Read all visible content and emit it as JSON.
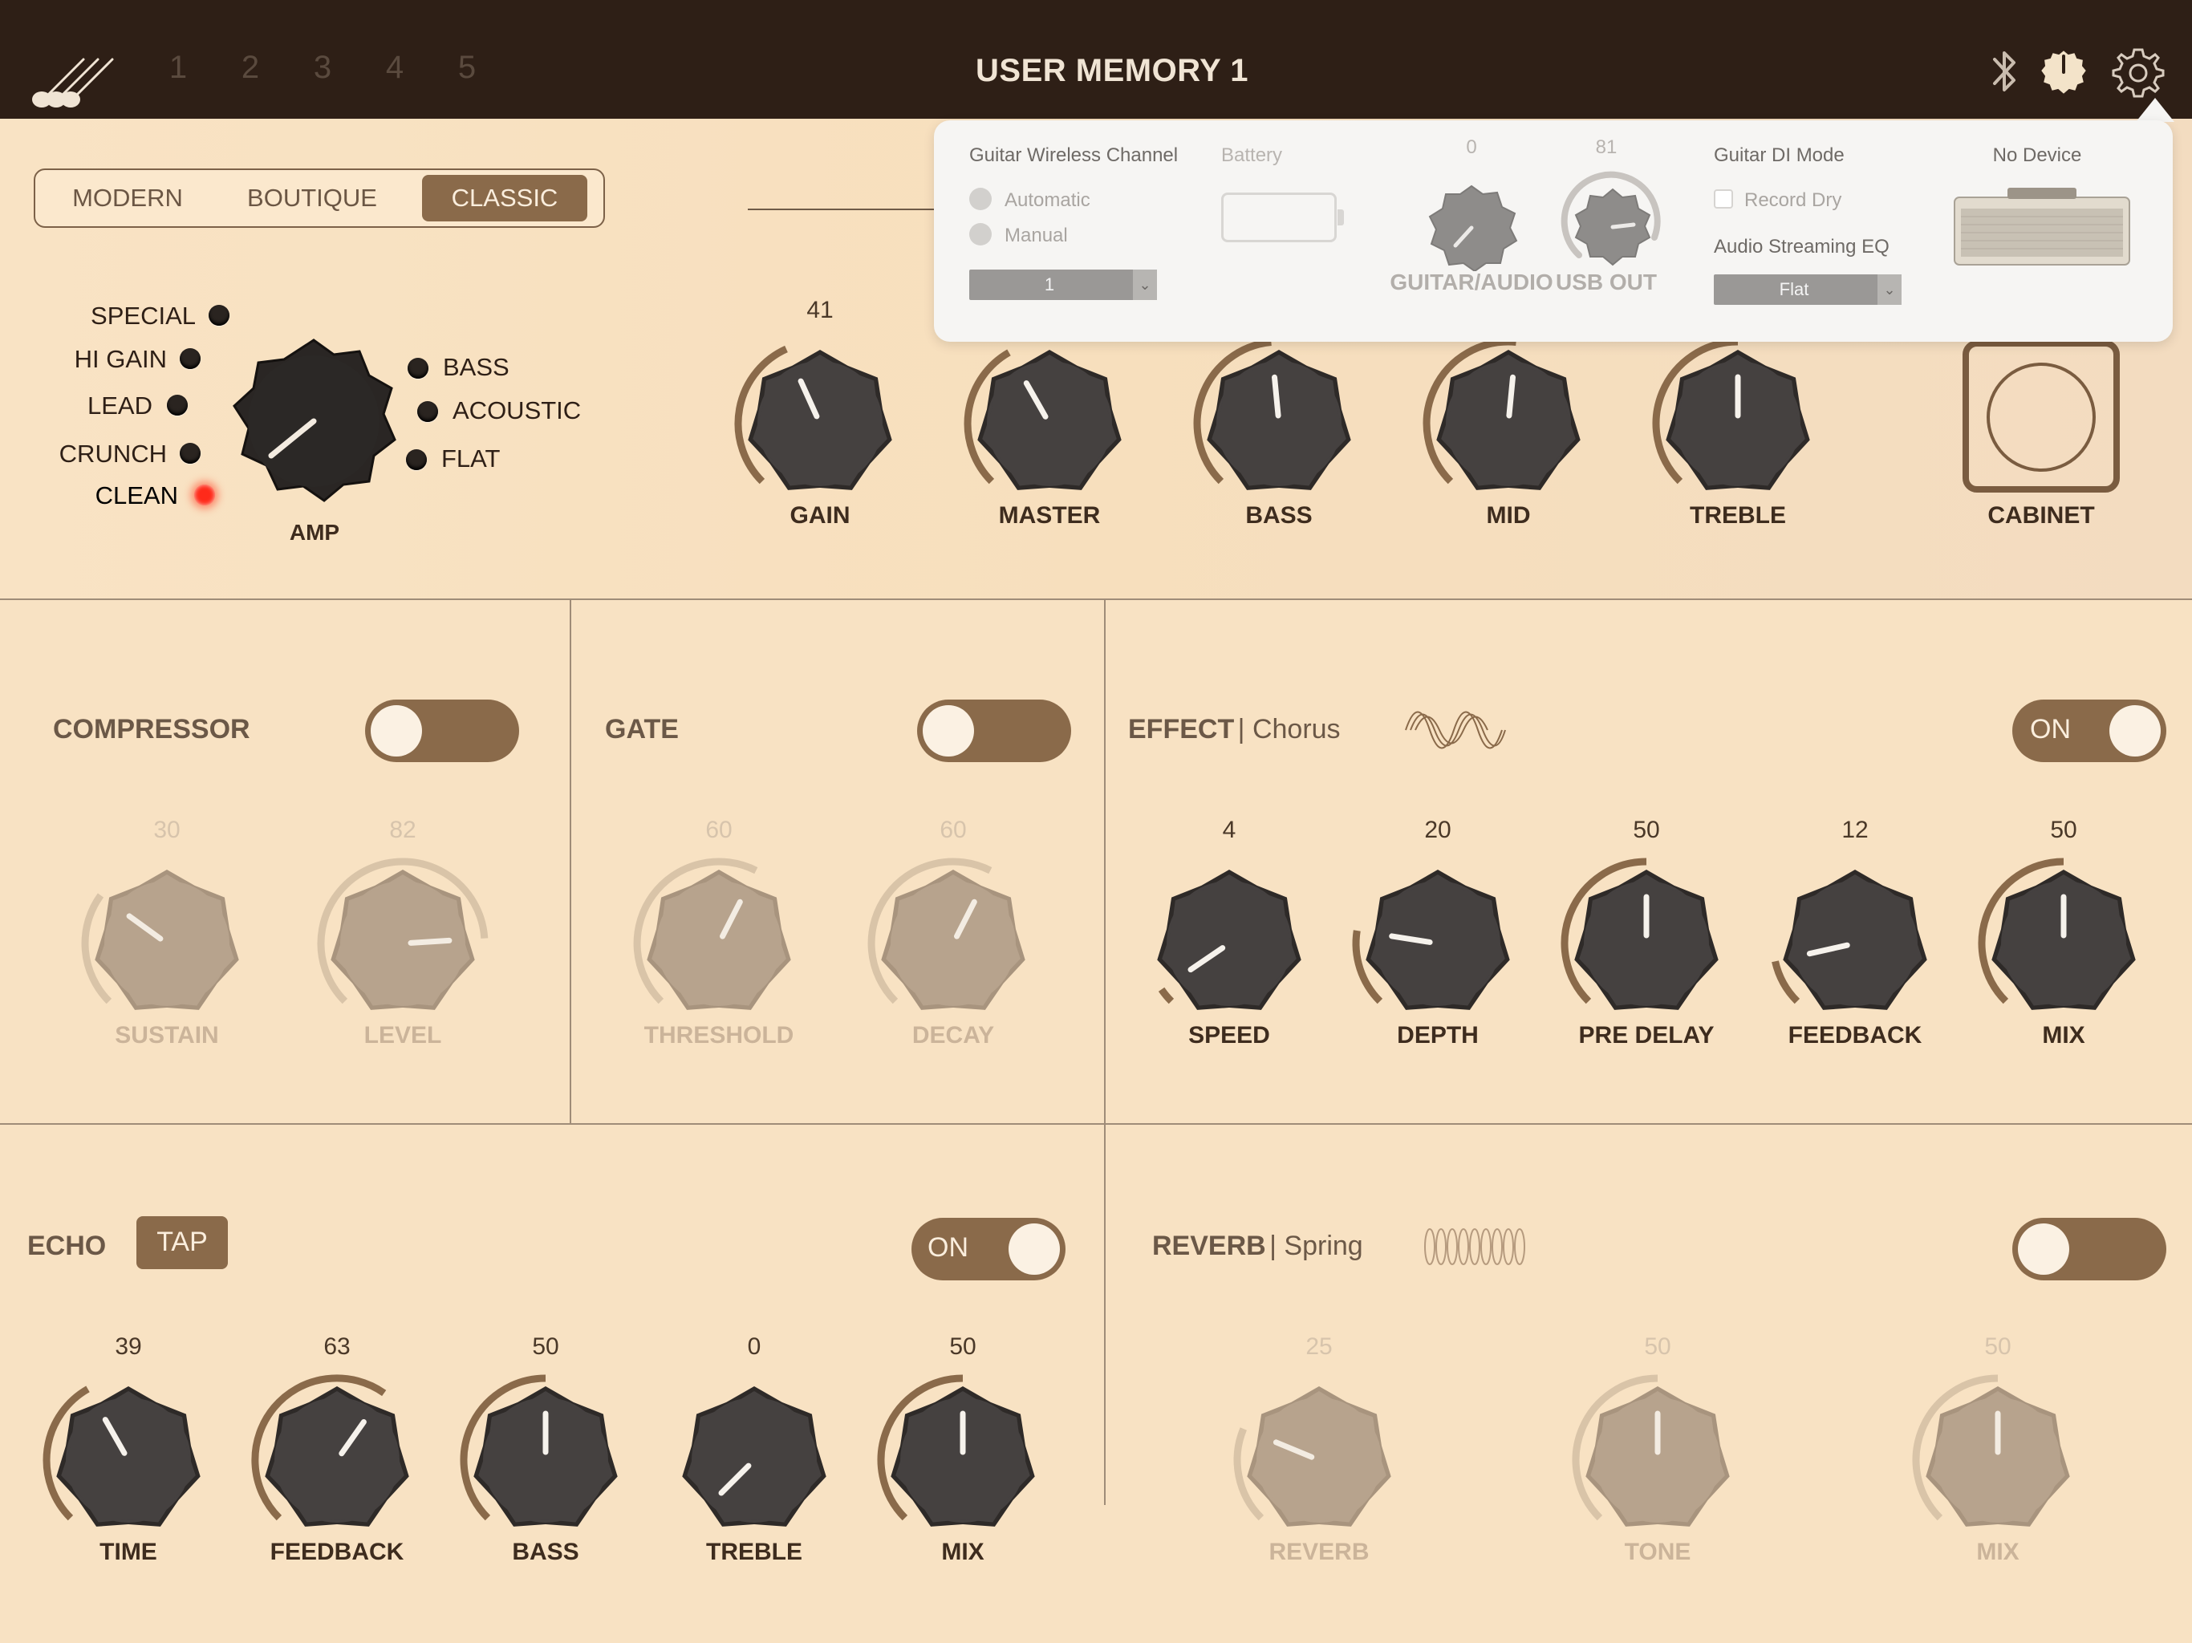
{
  "header": {
    "title": "USER MEMORY 1",
    "memory_slots": [
      "1",
      "2",
      "3",
      "4",
      "5"
    ]
  },
  "icons": {
    "logo": "guitars-logo-icon",
    "bluetooth": "bluetooth-icon",
    "tuner": "tuner-icon",
    "settings": "gear-icon"
  },
  "amp": {
    "types": [
      "MODERN",
      "BOUTIQUE",
      "CLASSIC"
    ],
    "selected_type": "CLASSIC",
    "channels": [
      "SPECIAL",
      "HI GAIN",
      "LEAD",
      "CRUNCH",
      "CLEAN"
    ],
    "active_channel": "CLEAN",
    "selector_label": "AMP",
    "eq_modes": [
      "BASS",
      "ACOUSTIC",
      "FLAT"
    ],
    "knobs": [
      {
        "label": "GAIN",
        "value": "41"
      },
      {
        "label": "MASTER",
        "value": ""
      },
      {
        "label": "BASS",
        "value": ""
      },
      {
        "label": "MID",
        "value": ""
      },
      {
        "label": "TREBLE",
        "value": ""
      }
    ],
    "cabinet_label": "CABINET"
  },
  "compressor": {
    "title": "COMPRESSOR",
    "knobs": [
      {
        "label": "SUSTAIN",
        "value": "30"
      },
      {
        "label": "LEVEL",
        "value": "82"
      }
    ]
  },
  "gate": {
    "title": "GATE",
    "knobs": [
      {
        "label": "THRESHOLD",
        "value": "60"
      },
      {
        "label": "DECAY",
        "value": "60"
      }
    ]
  },
  "effect": {
    "title": "EFFECT",
    "type": "| Chorus",
    "toggle_label": "ON",
    "knobs": [
      {
        "label": "SPEED",
        "value": "4"
      },
      {
        "label": "DEPTH",
        "value": "20"
      },
      {
        "label": "PRE DELAY",
        "value": "50"
      },
      {
        "label": "FEEDBACK",
        "value": "12"
      },
      {
        "label": "MIX",
        "value": "50"
      }
    ]
  },
  "echo": {
    "title": "ECHO",
    "tap_label": "TAP",
    "toggle_label": "ON",
    "knobs": [
      {
        "label": "TIME",
        "value": "39"
      },
      {
        "label": "FEEDBACK",
        "value": "63"
      },
      {
        "label": "BASS",
        "value": "50"
      },
      {
        "label": "TREBLE",
        "value": "0"
      },
      {
        "label": "MIX",
        "value": "50"
      }
    ]
  },
  "reverb": {
    "title": "REVERB",
    "type": "| Spring",
    "knobs": [
      {
        "label": "REVERB",
        "value": "25"
      },
      {
        "label": "TONE",
        "value": "50"
      },
      {
        "label": "MIX",
        "value": "50"
      }
    ]
  },
  "settings_popover": {
    "wireless_title": "Guitar Wireless Channel",
    "automatic_label": "Automatic",
    "manual_label": "Manual",
    "channel_value": "1",
    "battery_label": "Battery",
    "guitar_audio_label": "GUITAR/AUDIO",
    "guitar_audio_value": "0",
    "usb_out_label": "USB OUT",
    "usb_out_value": "81",
    "di_mode_title": "Guitar DI Mode",
    "record_dry_label": "Record Dry",
    "streaming_eq_title": "Audio Streaming EQ",
    "streaming_eq_value": "Flat",
    "device_label": "No Device"
  },
  "colors": {
    "accent": "#8a6a4a",
    "topbar": "#2e1f16",
    "background": "#f8e2c3",
    "led_on": "#ff2a1a"
  }
}
